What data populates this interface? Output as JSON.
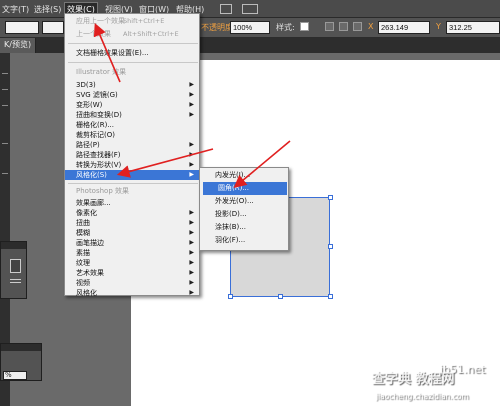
{
  "menubar": {
    "items": [
      "文字(T)",
      "选择(S)",
      "效果(C)",
      "视图(V)",
      "窗口(W)",
      "帮助(H)"
    ],
    "active_index": 2
  },
  "controlbar": {
    "opacity_label": "不透明度",
    "opacity_value": "100%",
    "style_label": "样式:",
    "x_value": "263.149",
    "y_value": "312.25"
  },
  "tab": {
    "label": "K/预览)"
  },
  "effect_menu": {
    "apply_last": {
      "label": "应用上一个效果",
      "shortcut": "Shift+Ctrl+E"
    },
    "last_effect": {
      "label": "上一个效果",
      "shortcut": "Alt+Shift+Ctrl+E"
    },
    "doc_raster": "文档栅格效果设置(E)...",
    "illustrator_header": "Illustrator 效果",
    "illustrator_items": [
      "3D(3)",
      "SVG 滤镜(G)",
      "变形(W)",
      "扭曲和变换(D)",
      "栅格化(R)...",
      "裁剪标记(O)",
      "路径(P)",
      "路径查找器(F)",
      "转换为形状(V)",
      "风格化(S)"
    ],
    "photoshop_header": "Photoshop 效果",
    "photoshop_items": [
      "效果画廊...",
      "像素化",
      "扭曲",
      "模糊",
      "画笔描边",
      "素描",
      "纹理",
      "艺术效果",
      "视频",
      "风格化"
    ]
  },
  "stylize_submenu": {
    "items": [
      "内发光(I)...",
      "圆角(R)...",
      "外发光(O)...",
      "投影(D)...",
      "涂抹(B)...",
      "羽化(F)..."
    ],
    "highlighted_index": 1
  },
  "status": {
    "percent": "%"
  },
  "watermark": {
    "line1": "查字典 教程网",
    "line2": "jiaocheng.chazidian.com",
    "site": "jb51.net"
  },
  "colors": {
    "highlight": "#3b76d6",
    "arrow": "#e02020"
  }
}
